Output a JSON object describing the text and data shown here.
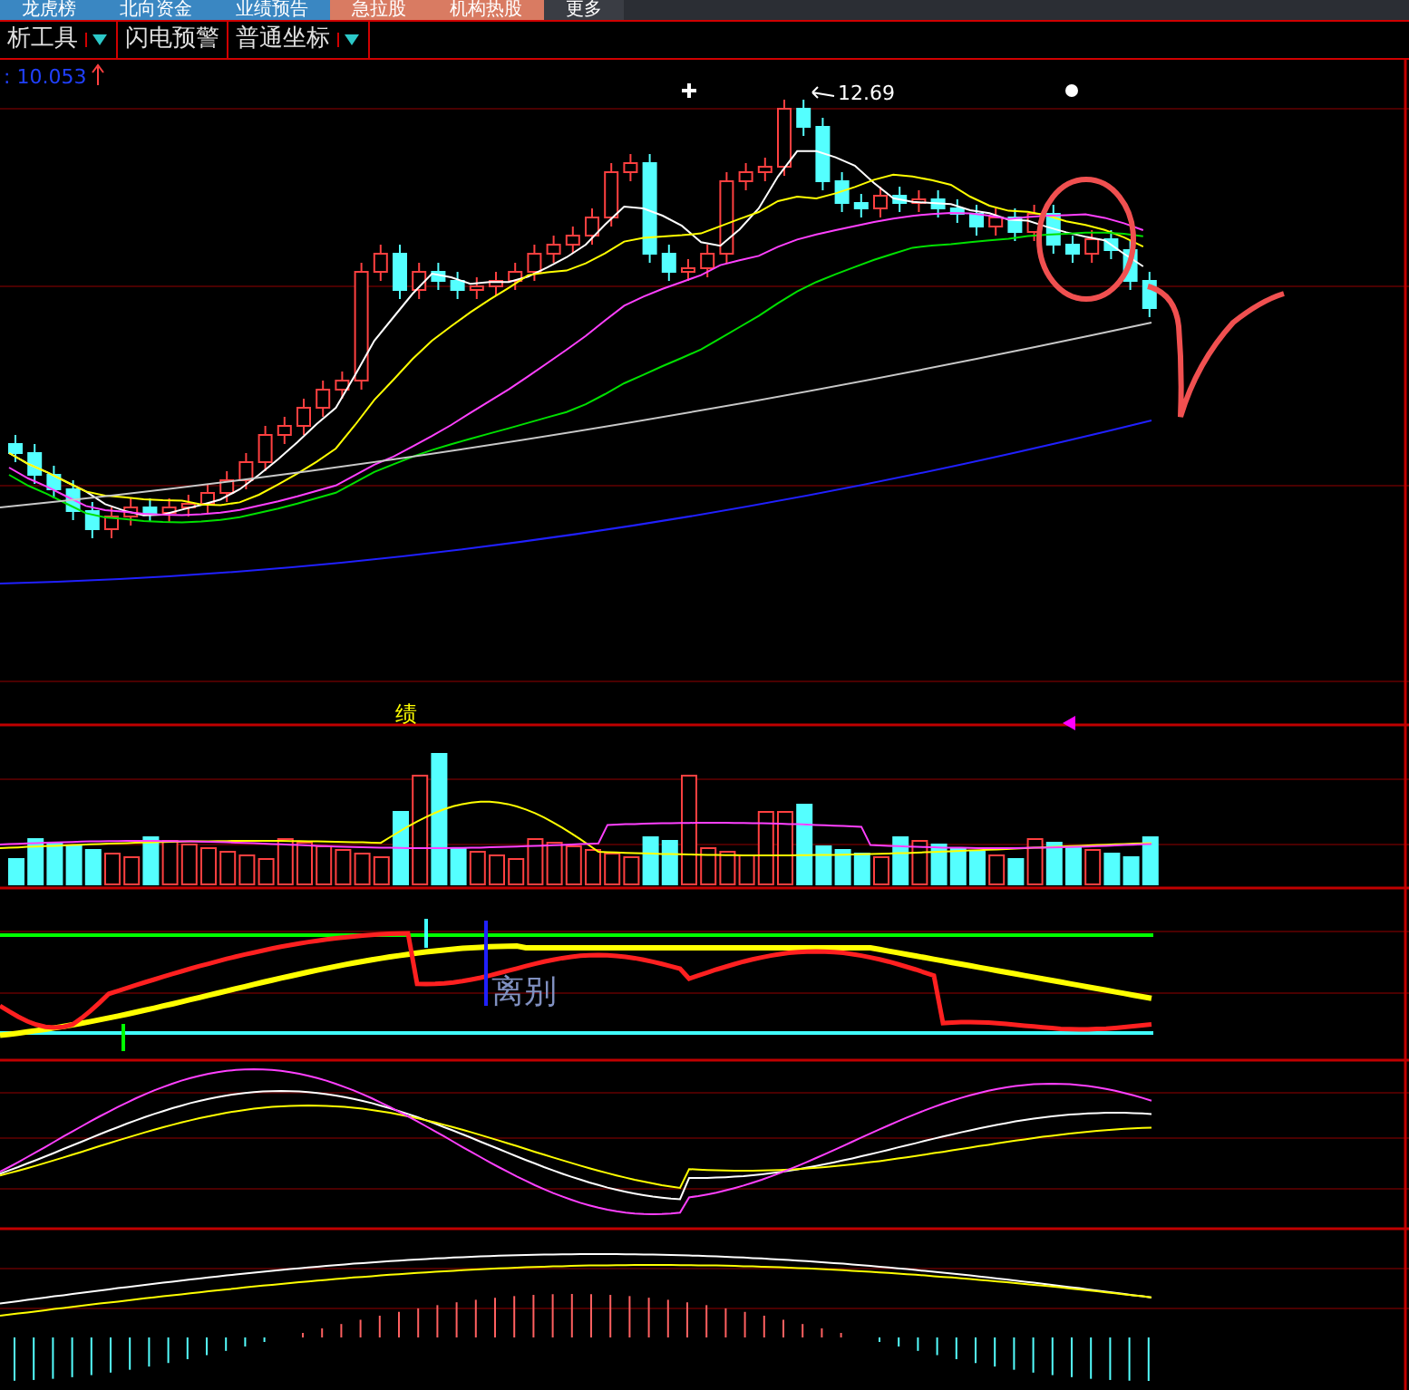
{
  "top_tabs": [
    {
      "label": "龙虎榜",
      "color": "#3a87c2"
    },
    {
      "label": "北向资金",
      "color": "#3a87c2"
    },
    {
      "label": "业绩预告",
      "color": "#3a87c2"
    },
    {
      "label": "急拉股",
      "color": "#d97b62"
    },
    {
      "label": "机构热股",
      "color": "#d97b62"
    },
    {
      "label": "更多",
      "color": "#3a3d44"
    }
  ],
  "toolbar": [
    {
      "label": "析工具",
      "dropdown": true
    },
    {
      "label": "闪电预警",
      "dropdown": false
    },
    {
      "label": "普通坐标",
      "dropdown": true
    }
  ],
  "chart": {
    "low_marker": ": 10.053",
    "high_marker": "12.69",
    "event_label": "绩",
    "signal_label": "离别"
  }
}
